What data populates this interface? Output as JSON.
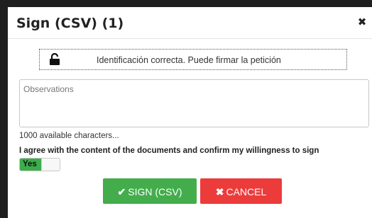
{
  "dialog": {
    "title": "Sign (CSV) (1)",
    "close_icon": "close-icon",
    "identification": {
      "icon": "unlock-icon",
      "text": "Identificación correcta. Puede firmar la petición"
    },
    "observations": {
      "placeholder": "Observations",
      "value": ""
    },
    "char_count": "1000 available characters...",
    "agree_text": "I agree with the content of the documents and confirm my willingness to sign",
    "toggle": {
      "label": "Yes",
      "state": "on"
    },
    "buttons": {
      "sign_label": "SIGN (CSV)",
      "sign_icon": "check-icon",
      "cancel_label": "CANCEL",
      "cancel_icon": "x-icon"
    }
  },
  "colors": {
    "sign_button": "#43ad4c",
    "cancel_button": "#ec3b3b",
    "toggle_on": "#3cad4a"
  }
}
